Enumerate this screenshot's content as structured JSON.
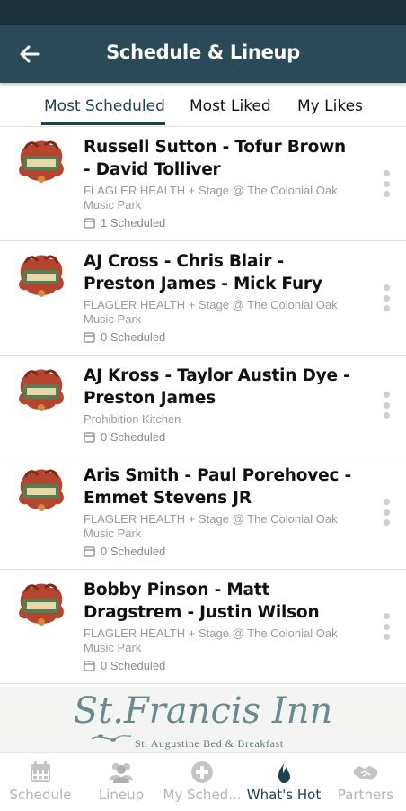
{
  "header": {
    "title": "Schedule & Lineup"
  },
  "tabs": [
    {
      "label": "Most Scheduled",
      "active": true
    },
    {
      "label": "Most Liked",
      "active": false
    },
    {
      "label": "My Likes",
      "active": false
    }
  ],
  "events": [
    {
      "title": "Russell Sutton - Tofur Brown - David Tolliver",
      "venue": "FLAGLER HEALTH + Stage @ The Colonial Oak Music Park",
      "scheduled": "1 Scheduled"
    },
    {
      "title": "AJ Cross - Chris Blair - Preston James - Mick Fury",
      "venue": "FLAGLER HEALTH + Stage @ The Colonial Oak Music Park",
      "scheduled": "0 Scheduled"
    },
    {
      "title": "AJ Kross - Taylor Austin Dye - Preston James",
      "venue": "Prohibition Kitchen",
      "scheduled": "0 Scheduled"
    },
    {
      "title": "Aris Smith - Paul Porehovec - Emmet Stevens JR",
      "venue": "FLAGLER HEALTH + Stage @ The Colonial Oak Music Park",
      "scheduled": "0 Scheduled"
    },
    {
      "title": "Bobby Pinson - Matt Dragstrem - Justin Wilson",
      "venue": "FLAGLER HEALTH + Stage @ The Colonial Oak Music Park",
      "scheduled": "0 Scheduled"
    }
  ],
  "banner": {
    "title": "St.Francis Inn",
    "subtitle": "St. Augustine Bed & Breakfast"
  },
  "bottom_nav": [
    {
      "label": "Schedule",
      "icon": "calendar-icon",
      "active": false
    },
    {
      "label": "Lineup",
      "icon": "people-icon",
      "active": false
    },
    {
      "label": "My Sched...",
      "icon": "plus-circle-icon",
      "active": false
    },
    {
      "label": "What's Hot",
      "icon": "flame-icon",
      "active": true
    },
    {
      "label": "Partners",
      "icon": "handshake-icon",
      "active": false
    }
  ],
  "colors": {
    "header_bg": "#2b4a57",
    "status_bg": "#1d3038",
    "accent": "#1f3f4f",
    "inactive": "#b5b5b5"
  }
}
